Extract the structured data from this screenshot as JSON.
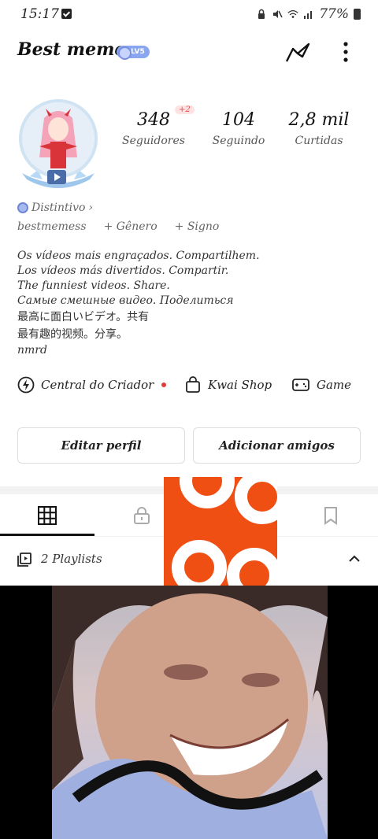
{
  "status_bar": {
    "time": "15:17",
    "battery": "77%"
  },
  "profile": {
    "name": "Best memes",
    "level": "LV5",
    "followers_value": "348",
    "followers_label": "Seguidores",
    "followers_new": "+2",
    "following_value": "104",
    "following_label": "Seguindo",
    "likes_value": "2,8 mil",
    "likes_label": "Curtidas",
    "badge_link": "Distintivo",
    "username": "bestmemess",
    "gender_link": "+ Gênero",
    "sign_link": "+ Signo",
    "bio_lines": [
      "Os vídeos mais engraçados. Compartilhem.",
      "Los vídeos más divertidos. Compartir.",
      "The funniest videos. Share.",
      "Самые смешные видео. Поделиться",
      "最高に面白いビデオ。共有",
      "最有趣的视频。分享。",
      "nmrd"
    ]
  },
  "shortcuts": {
    "creator": "Central do Criador",
    "shop": "Kwai Shop",
    "game": "Game"
  },
  "buttons": {
    "edit_profile": "Editar perfil",
    "add_friends": "Adicionar amigos"
  },
  "tabs": [
    "grid-icon",
    "lock-icon",
    "heart-icon",
    "bookmark-icon"
  ],
  "playlists": {
    "label": "2 Playlists"
  },
  "colors": {
    "badge_blue": "#8aa6f0",
    "notification_red": "#e23a3a",
    "sticker_orange": "#f04f14"
  }
}
